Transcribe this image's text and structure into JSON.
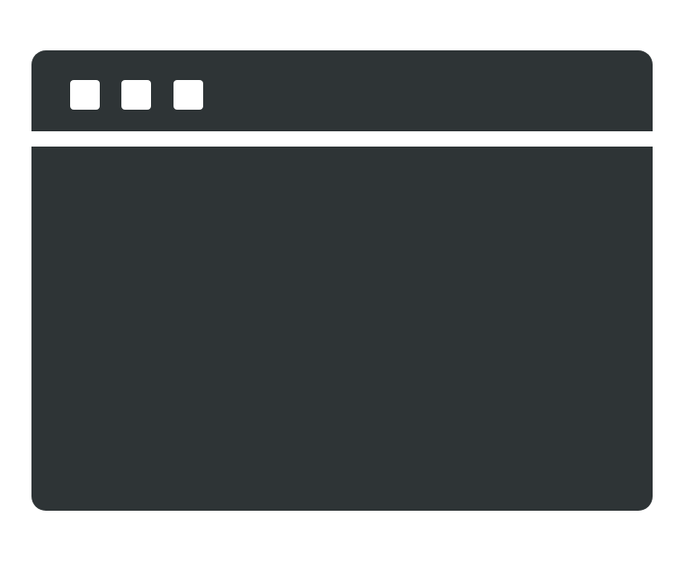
{
  "icon": {
    "name": "browser-window-icon",
    "colors": {
      "background": "#ffffff",
      "window": "#2e3436",
      "buttons": "#ffffff"
    },
    "title_bar": {
      "buttons": [
        {
          "name": "window-button-1-icon"
        },
        {
          "name": "window-button-2-icon"
        },
        {
          "name": "window-button-3-icon"
        }
      ]
    }
  }
}
